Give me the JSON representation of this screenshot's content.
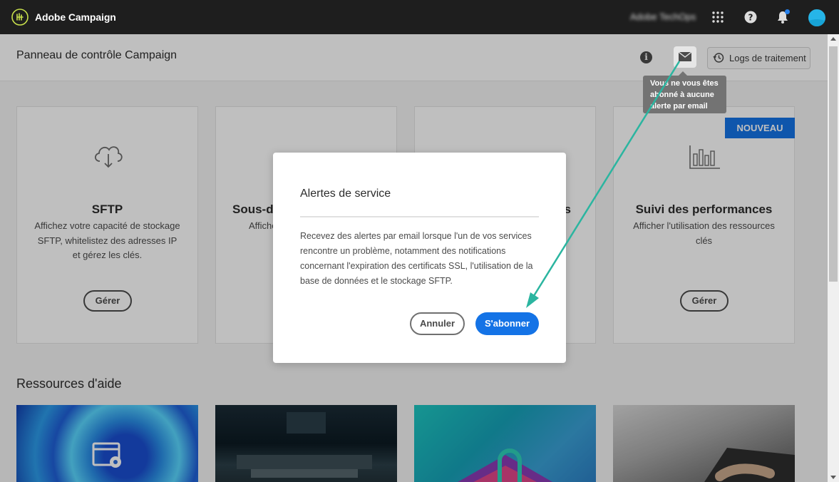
{
  "topbar": {
    "app_name": "Adobe Campaign",
    "org_name": "Adobe TechOps",
    "icons": [
      "apps-grid-icon",
      "help-icon",
      "bell-icon"
    ]
  },
  "header": {
    "title": "Panneau de contrôle Campaign",
    "logs_button": "Logs de traitement"
  },
  "cards": [
    {
      "title": "SFTP",
      "description": "Affichez votre capacité de stockage SFTP, whitelistez des adresses IP et gérez les clés.",
      "button": "Gérer",
      "icon": "cloud-download-icon"
    },
    {
      "title": "Sous-do",
      "description": "Affiche",
      "icon": "globe-icon"
    },
    {
      "title": "s",
      "description": "",
      "icon": "globe-icon"
    },
    {
      "title": "Suivi des performances",
      "description": "Afficher l'utilisation des ressources clés",
      "button": "Gérer",
      "badge": "NOUVEAU",
      "icon": "bar-chart-icon"
    }
  ],
  "resources": {
    "title": "Ressources d'aide"
  },
  "tooltip": {
    "text": "Vous ne vous êtes abonné à aucune alerte par email"
  },
  "modal": {
    "title": "Alertes de service",
    "body": "Recevez des alertes par email lorsque l'un de vos services rencontre un problème, notamment des notifications concernant l'expiration des certificats SSL, l'utilisation de la base de données et le stockage SFTP.",
    "cancel": "Annuler",
    "confirm": "S'abonner"
  },
  "colors": {
    "accent": "#1473e6",
    "annotation_arrow": "#2bb5a0",
    "topbar": "#1e1e1e"
  }
}
